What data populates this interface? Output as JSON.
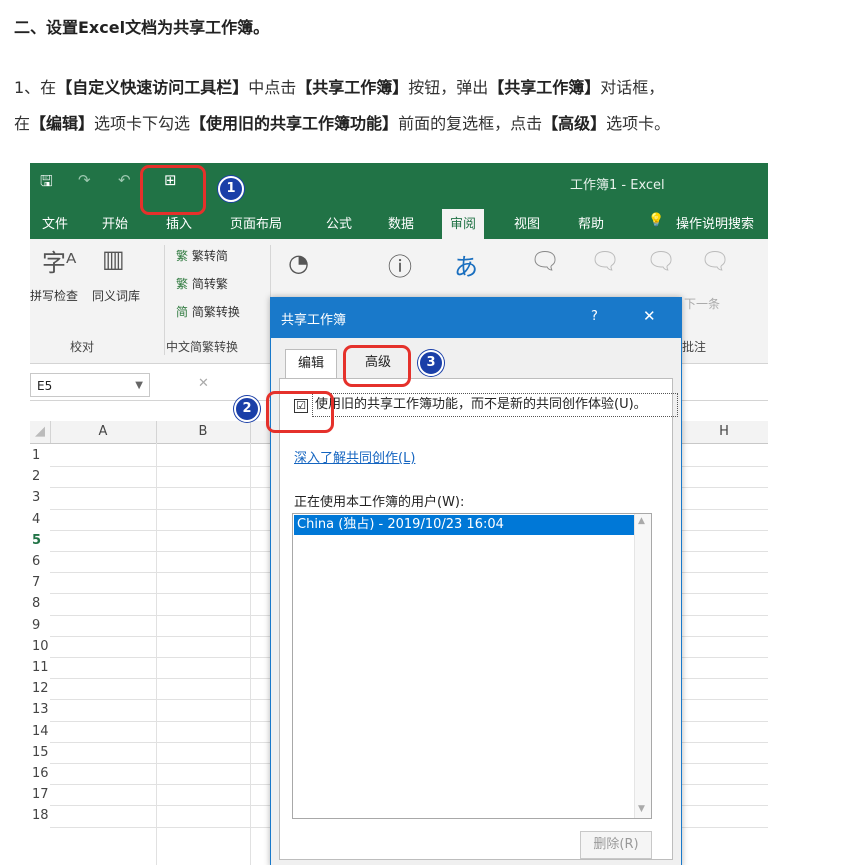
{
  "article": {
    "heading": "二、设置Excel文档为共享工作簿。",
    "p1": [
      "1、在",
      "【自定义快速访问工具栏】",
      "中点击",
      "【共享工作簿】",
      "按钮，弹出",
      "【共享工作簿】",
      "对话框，"
    ],
    "p2": [
      "在",
      "【编辑】",
      "选项卡下勾选",
      "【使用旧的共享工作簿功能】",
      "前面的复选框，点击",
      "【高级】",
      "选项卡。"
    ]
  },
  "excel": {
    "window_title": "工作簿1  -  Excel",
    "ribbon_tabs": [
      "文件",
      "开始",
      "插入",
      "页面布局",
      "公式",
      "数据",
      "审阅",
      "视图",
      "帮助",
      "操作说明搜索"
    ],
    "active_tab": "审阅",
    "ribbon": {
      "spell_check": "拼写检查",
      "thesaurus": "同义词库",
      "proofing_group": "校对",
      "trad_to_simp": "繁转简",
      "simp_to_trad": "简转繁",
      "convert": "简繁转换",
      "chinese_conv_group": "中文简繁转换",
      "next_comment": "下一条",
      "comments_group": "批注"
    },
    "name_box": "E5",
    "columns": [
      "A",
      "B",
      "H"
    ],
    "rows": [
      "1",
      "2",
      "3",
      "4",
      "5",
      "6",
      "7",
      "8",
      "9",
      "10",
      "11",
      "12",
      "13",
      "14",
      "15",
      "16",
      "17",
      "18"
    ],
    "active_row": "5"
  },
  "dialog": {
    "title": "共享工作簿",
    "help": "?",
    "close": "✕",
    "tabs": [
      "编辑",
      "高级"
    ],
    "checkbox_checked": true,
    "checkbox_mark": "☑",
    "checkbox_label": "使用旧的共享工作簿功能，而不是新的共同创作体验(U)。",
    "link": "深入了解共同创作(L)",
    "users_label": "正在使用本工作簿的用户(W):",
    "users": [
      "China (独占) - 2019/10/23 16:04"
    ],
    "remove_button": "删除(R)"
  },
  "annotations": {
    "badges": [
      "1",
      "2",
      "3"
    ],
    "color": "#e5312b",
    "badge_color": "#1a3fa8"
  },
  "colors": {
    "excel_green": "#217346",
    "dialog_blue": "#1979ca",
    "selection": "#0078d7"
  }
}
